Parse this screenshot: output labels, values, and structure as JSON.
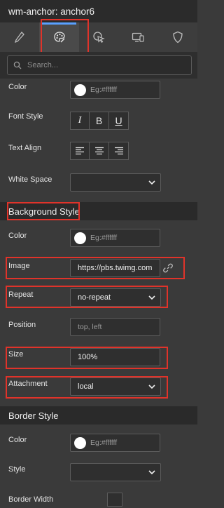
{
  "window": {
    "title": "wm-anchor: anchor6"
  },
  "tabs": [
    {
      "icon": "pencil-icon"
    },
    {
      "icon": "palette-icon",
      "active": true
    },
    {
      "icon": "cursor-click-icon"
    },
    {
      "icon": "devices-icon"
    },
    {
      "icon": "shield-icon"
    }
  ],
  "search": {
    "placeholder": "Search..."
  },
  "text_style": {
    "color_label": "Color",
    "color_placeholder": "Eg:#ffffff",
    "font_style_label": "Font Style",
    "font_style_buttons": [
      "I",
      "B",
      "U"
    ],
    "text_align_label": "Text Align",
    "white_space_label": "White Space",
    "white_space_value": ""
  },
  "background_style": {
    "header": "Background Style",
    "color_label": "Color",
    "color_placeholder": "Eg:#ffffff",
    "image_label": "Image",
    "image_value": "https://pbs.twimg.com",
    "repeat_label": "Repeat",
    "repeat_value": "no-repeat",
    "position_label": "Position",
    "position_placeholder": "top, left",
    "size_label": "Size",
    "size_value": "100%",
    "attachment_label": "Attachment",
    "attachment_value": "local"
  },
  "border_style": {
    "header": "Border Style",
    "color_label": "Color",
    "color_placeholder": "Eg:#ffffff",
    "style_label": "Style",
    "style_value": "",
    "width_label": "Border Width"
  },
  "colors": {
    "accent": "#5aa0ff",
    "highlight": "#e0332a"
  }
}
